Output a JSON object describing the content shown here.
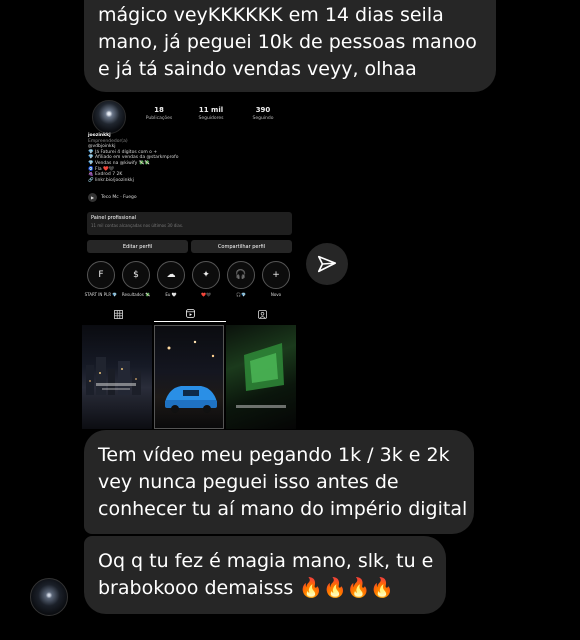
{
  "messages": {
    "m1_lines": [
      "mágico veyKKKKKK em 14 dias seila",
      "mano, já peguei 10k de pessoas manoo",
      "e já tá saindo vendas veyy, olhaa"
    ],
    "m2_lines": [
      "Tem vídeo meu pegando 1k / 3k e 2k",
      "vey nunca peguei isso antes de",
      "conhecer tu aí mano do império digital"
    ],
    "m3_lines": [
      "Oq q tu fez é magia mano, slk, tu e",
      "brabokooo demaisss 🔥🔥🔥🔥"
    ]
  },
  "profile": {
    "stats": [
      {
        "value": "18",
        "label": "Publicações"
      },
      {
        "value": "11 mil",
        "label": "Seguidores"
      },
      {
        "value": "390",
        "label": "Seguindo"
      }
    ],
    "bio_lines": [
      "joozinkkj",
      "Empreendedor(a)",
      "@vdbjoinkkj",
      "💎 Já Faturei 4 dígitos com o +",
      "💎 Afiliado em vendas da @starkmprofo",
      "💎 Vendas na @kiwify 💸💸",
      "🧿 Fla ❤️🖤",
      "🍇 Exdrod 7 2K",
      "🔗 linkr.bio/joozinkkj"
    ],
    "music": "Teco Mc · Fuego",
    "panel_title": "Painel profissional",
    "panel_sub": "11 mil contas alcançadas nos últimos 30 dias.",
    "edit_button": "Editar perfil",
    "share_button": "Compartilhar perfil",
    "highlights": [
      {
        "glyph": "F",
        "label": "START IN PLR 💎"
      },
      {
        "glyph": "$",
        "label": "Resultados 💸"
      },
      {
        "glyph": "☁",
        "label": "Eu 🤍"
      },
      {
        "glyph": "✦",
        "label": "❤️🖤"
      },
      {
        "glyph": "🎧",
        "label": "🎧💎"
      },
      {
        "glyph": "+",
        "label": "Novo"
      }
    ]
  }
}
